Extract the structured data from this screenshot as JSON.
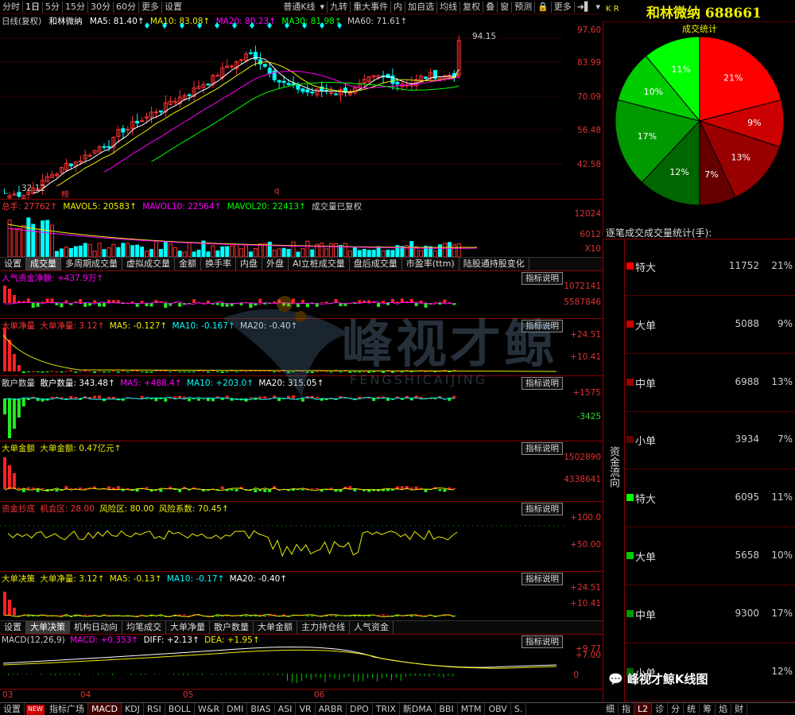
{
  "toolbar_left": [
    "分时",
    "1日",
    "5分",
    "15分",
    "30分",
    "60分",
    "更多",
    "设置"
  ],
  "toolbar_right": [
    "普通K线",
    "九转",
    "重大事件",
    "内",
    "加自选",
    "均线",
    "复权",
    "叠",
    "窗",
    "预测",
    "更多"
  ],
  "header": {
    "code_kr": "K R",
    "stock_title": "和林微纳 688661"
  },
  "kline": {
    "title": "日线(复权)",
    "name": "和林微纳",
    "ma5": "MA5: 81.40↑",
    "ma10": "MA10: 83.08↑",
    "ma20": "MA20: 80.23↑",
    "ma30": "MA30: 81.98↑",
    "ma60": "MA60: 71.61↑",
    "high": "94.15",
    "low": "32.12",
    "axis": [
      "97.60",
      "83.99",
      "70.09",
      "56.48",
      "42.58"
    ],
    "mark_l": "L",
    "mark_bang": "榜",
    "mark_q": "q"
  },
  "volume": {
    "total": "总手: 27762↑",
    "mavol5": "MAVOL5: 20583↑",
    "mavol10": "MAVOL10: 22564↑",
    "mavol20": "MAVOL20: 22413↑",
    "note": "成交量已复权",
    "axis": [
      "12024",
      "6012",
      "X10"
    ]
  },
  "tabs1": [
    "设置",
    "成交量",
    "多周期成交量",
    "虚拟成交量",
    "金额",
    "换手率",
    "内盘",
    "外盘",
    "AI立桩成交量",
    "盘后成交量",
    "市盈率(ttm)",
    "陆股通持股变化"
  ],
  "ind_btn": "指标说明",
  "p1": {
    "title": "人气资金净额: +437.9万↑",
    "axis": [
      "1072141",
      "5587846"
    ]
  },
  "p2": {
    "t1": "大单净量",
    "t2": "大单净量: 3.12↑",
    "t3": "MA5: -0.127↑",
    "t4": "MA10: -0.167↑",
    "t5": "MA20: -0.40↑",
    "axis": [
      "+24.51",
      "+10.41"
    ]
  },
  "p3": {
    "t1": "散户数量",
    "t2": "散户数量: 343.48↑",
    "t3": "MA5: +488.4↑",
    "t4": "MA10: +203.0↑",
    "t5": "MA20: 315.05↑",
    "axis": [
      "+1575",
      "-3425"
    ]
  },
  "p4": {
    "t1": "大单金额",
    "t2": "大单金额: 0.47亿元↑",
    "axis": [
      "1502890",
      "4338641"
    ]
  },
  "p5": {
    "t1": "资金抄底",
    "t2": "机会区: 28.00",
    "t3": "风险区: 80.00",
    "t4": "风险系数: 70.45↑",
    "axis": [
      "+100.0",
      "+50.00"
    ]
  },
  "p6": {
    "t1": "大单决策",
    "t2": "大单净量: 3.12↑",
    "t3": "MA5: -0.13↑",
    "t4": "MA10: -0.17↑",
    "t5": "MA20: -0.40↑",
    "axis": [
      "+24.51",
      "+10.41"
    ]
  },
  "tabs2": [
    "设置",
    "大单决策",
    "机构日动向",
    "均笔成交",
    "大单净量",
    "散户数量",
    "大单金额",
    "主力持仓线",
    "人气资金"
  ],
  "macd": {
    "t1": "MACD(12,26,9)",
    "t2": "MACD: +0.353↑",
    "t3": "DIFF: +2.13↑",
    "t4": "DEA: +1.95↑",
    "axis": [
      "+9.77",
      "+7.00",
      "0"
    ]
  },
  "dates": [
    "03",
    "04",
    "05",
    "06"
  ],
  "pie": {
    "title": "成交统计",
    "labels": [
      "21%",
      "9%",
      "13%",
      "7%",
      "12%",
      "17%",
      "10%",
      "11%"
    ]
  },
  "flow": {
    "header": "逐笔成交成交量统计(手):",
    "side_label": "资金流向",
    "rows": [
      {
        "label": "特大",
        "value": "11752",
        "pct": "21%",
        "color": "#ff0000"
      },
      {
        "label": "大单",
        "value": "5088",
        "pct": "9%",
        "color": "#cc0000"
      },
      {
        "label": "中单",
        "value": "6988",
        "pct": "13%",
        "color": "#990000"
      },
      {
        "label": "小单",
        "value": "3934",
        "pct": "7%",
        "color": "#660000"
      },
      {
        "label": "特大",
        "value": "6095",
        "pct": "11%",
        "color": "#00ff00"
      },
      {
        "label": "大单",
        "value": "5658",
        "pct": "10%",
        "color": "#00cc00"
      },
      {
        "label": "中单",
        "value": "9300",
        "pct": "17%",
        "color": "#009900"
      },
      {
        "label": "小单",
        "value": "",
        "pct": "12%",
        "color": "#006600"
      }
    ]
  },
  "watermark": {
    "main": "峰视才鲸",
    "sub": "FENGSHICAIJING",
    "wechat": "峰视才鲸K线图"
  },
  "bottom_tabs": [
    "设置",
    "NEW",
    "指标广场",
    "MACD",
    "KDJ",
    "RSI",
    "BOLL",
    "W&R",
    "DMI",
    "BIAS",
    "ASI",
    "VR",
    "ARBR",
    "DPO",
    "TRIX",
    "新DMA",
    "BBI",
    "MTM",
    "OBV",
    "S."
  ],
  "right_bottom_tabs": [
    "细",
    "指",
    "L2",
    "诊",
    "分",
    "统",
    "筹",
    "焰",
    "财"
  ]
}
